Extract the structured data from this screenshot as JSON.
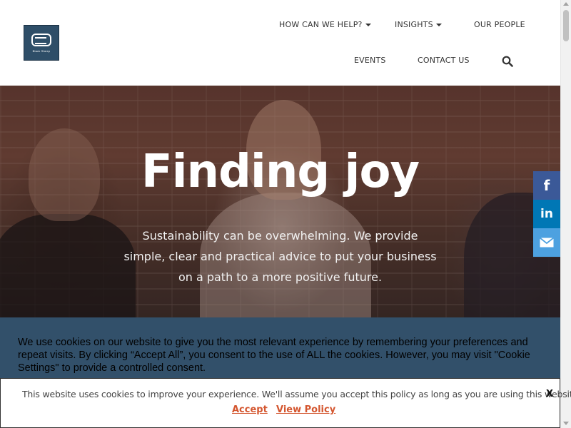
{
  "logo": {
    "text": "Black Sheep Sustainability",
    "alt": "Black Sheep"
  },
  "nav": {
    "items": [
      {
        "label": "HOW CAN WE HELP?",
        "has_dropdown": true
      },
      {
        "label": "INSIGHTS",
        "has_dropdown": true
      },
      {
        "label": "OUR PEOPLE",
        "has_dropdown": false
      },
      {
        "label": "EVENTS",
        "has_dropdown": false
      },
      {
        "label": "CONTACT US",
        "has_dropdown": false
      }
    ],
    "search_icon": "search-icon"
  },
  "hero": {
    "title": "Finding joy",
    "text": "Sustainability can be overwhelming. We provide simple, clear and practical advice to put your business on a path to a more positive future."
  },
  "share": {
    "facebook": {
      "glyph": "f",
      "icon": "facebook-icon",
      "color": "#3b5998"
    },
    "linkedin": {
      "glyph": "in",
      "icon": "linkedin-icon",
      "color": "#0077b5"
    },
    "email": {
      "icon": "mail-icon",
      "color": "#4da1e0"
    }
  },
  "cookie_banner": {
    "text": "We use cookies on our website to give you the most relevant experience by remembering your preferences and repeat visits. By clicking “Accept All”, you consent to the use of ALL the cookies. However, you may visit \"Cookie Settings\" to provide a controlled consent.",
    "background": "#32506a"
  },
  "policy_bar": {
    "text": "This website uses cookies to improve your experience. We'll assume you accept this policy as long as you are using this website",
    "close_label": "X",
    "accept_label": "Accept",
    "view_policy_label": "View Policy",
    "link_color": "#d4562f"
  }
}
